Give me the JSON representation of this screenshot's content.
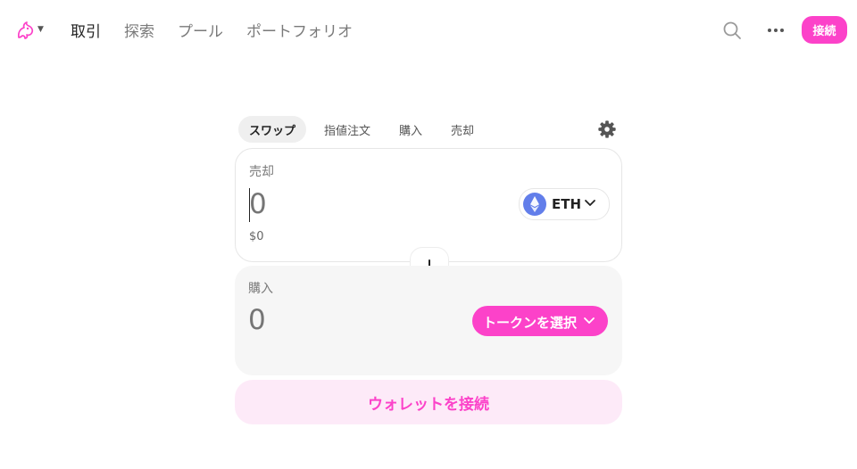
{
  "header": {
    "nav": [
      {
        "label": "取引",
        "active": true
      },
      {
        "label": "探索",
        "active": false
      },
      {
        "label": "プール",
        "active": false
      },
      {
        "label": "ポートフォリオ",
        "active": false
      }
    ],
    "connect_label": "接続",
    "icons": {
      "logo": "uniswap-unicorn-icon",
      "search": "search-icon",
      "more": "more-dots-icon"
    }
  },
  "swap": {
    "tabs": [
      {
        "label": "スワップ",
        "active": true
      },
      {
        "label": "指値注文",
        "active": false
      },
      {
        "label": "購入",
        "active": false
      },
      {
        "label": "売却",
        "active": false
      }
    ],
    "sell": {
      "label": "売却",
      "amount_placeholder": "0",
      "usd_value": "$0",
      "token": "ETH"
    },
    "buy": {
      "label": "購入",
      "amount_placeholder": "0",
      "select_token_label": "トークンを選択"
    },
    "wallet_button_label": "ウォレットを接続"
  },
  "colors": {
    "accent": "#fc42c9",
    "accent_soft": "#fdeaf8",
    "eth_blue": "#627eea"
  }
}
